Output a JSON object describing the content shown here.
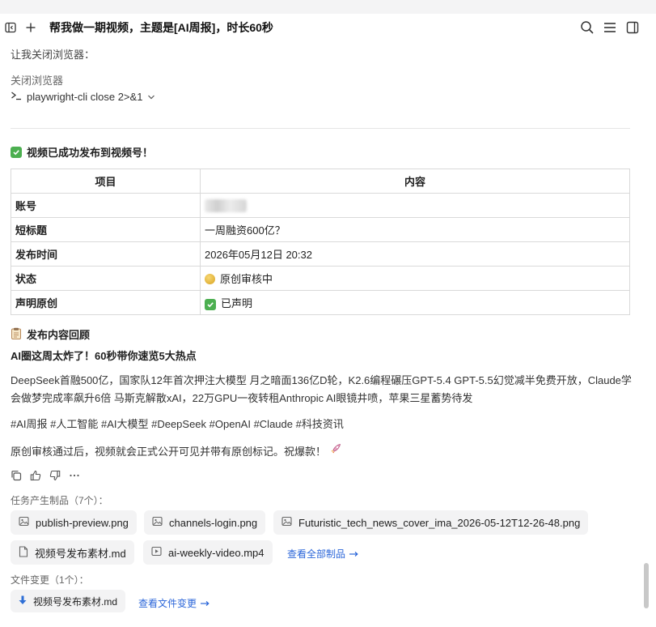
{
  "header": {
    "title": "帮我做一期视频，主题是[AI周报]，时长60秒",
    "icons": [
      "sidebar-toggle-icon",
      "plus-icon",
      "search-icon",
      "menu-icon",
      "panel-icon"
    ]
  },
  "messages": {
    "close_intro": "让我关闭浏览器：",
    "close_label": "关闭浏览器",
    "command": "playwright-cli close 2>&1",
    "success_title": "视频已成功发布到视频号！"
  },
  "table": {
    "headers": [
      "项目",
      "内容"
    ],
    "rows": [
      {
        "key": "账号",
        "value": ""
      },
      {
        "key": "短标题",
        "value": "一周融资600亿？"
      },
      {
        "key": "发布时间",
        "value": "2026年05月12日 20:32"
      },
      {
        "key": "状态",
        "value": "原创审核中"
      },
      {
        "key": "声明原创",
        "value": "已声明"
      }
    ]
  },
  "recap": {
    "heading": "发布内容回顾",
    "headline": "AI圈这周太炸了！60秒带你速览5大热点",
    "body": "DeepSeek首融500亿，国家队12年首次押注大模型 月之暗面136亿D轮，K2.6编程碾压GPT-5.4 GPT-5.5幻觉减半免费开放，Claude学会做梦完成率飙升6倍 马斯克解散xAI，22万GPU一夜转租Anthropic AI眼镜井喷，苹果三星蓄势待发",
    "tags": "#AI周报 #人工智能 #AI大模型 #DeepSeek #OpenAI #Claude #科技资讯",
    "closing": "原创审核通过后，视频就会正式公开可见并带有原创标记。祝爆款！"
  },
  "artifacts": {
    "label": "任务产生制品（7个）：",
    "files": [
      {
        "name": "publish-preview.png",
        "icon": "image-icon"
      },
      {
        "name": "channels-login.png",
        "icon": "image-icon"
      },
      {
        "name": "Futuristic_tech_news_cover_ima_2026-05-12T12-26-48.png",
        "icon": "image-icon"
      },
      {
        "name": "视频号发布素材.md",
        "icon": "document-icon"
      },
      {
        "name": "ai-weekly-video.mp4",
        "icon": "video-icon"
      }
    ],
    "view_all": "查看全部制品"
  },
  "changes": {
    "label": "文件变更（1个）：",
    "file": "视频号发布素材.md",
    "view": "查看文件变更"
  },
  "colors": {
    "accent": "#2b66d9",
    "success": "#4caf50"
  }
}
